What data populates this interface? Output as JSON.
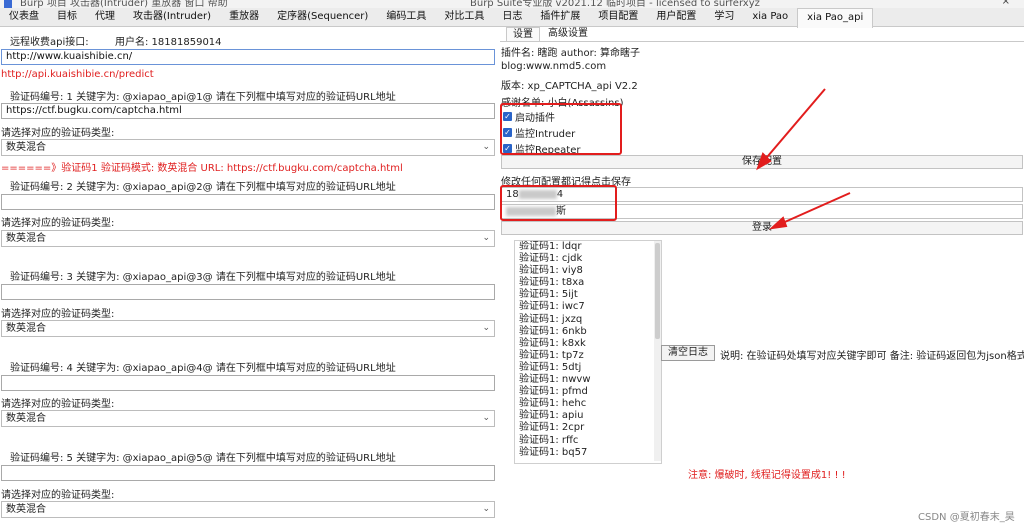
{
  "titlebar": {
    "left_text": "Burp 项目 攻击器(Intruder) 重放器 窗口 帮助",
    "center_text": "Burp Suite专业版 v2021.12 临时项目 - licensed to surferxyz",
    "close": "×"
  },
  "tabs": [
    "仪表盘",
    "目标",
    "代理",
    "攻击器(Intruder)",
    "重放器",
    "定序器(Sequencer)",
    "编码工具",
    "对比工具",
    "日志",
    "插件扩展",
    "项目配置",
    "用户配置",
    "学习",
    "xia Pao",
    "xia Pao_api"
  ],
  "left": {
    "api_label": "远程收费api接口:",
    "username_label": "用户名: 18181859014",
    "api_url": "http://www.kuaishibie.cn/",
    "predict_url": "http://api.kuaishibie.cn/predict",
    "blocks": [
      {
        "header": "验证码编号: 1  关键字为: @xiapao_api@1@    请在下列框中填写对应的验证码URL地址",
        "url": "https://ctf.bugku.com/captcha.html",
        "type_label": "请选择对应的验证码类型:",
        "type_value": "数英混合",
        "result": "======》验证码1  验证码模式: 数英混合  URL: https://ctf.bugku.com/captcha.html"
      },
      {
        "header": "验证码编号: 2  关键字为: @xiapao_api@2@    请在下列框中填写对应的验证码URL地址",
        "url": "",
        "type_label": "请选择对应的验证码类型:",
        "type_value": "数英混合"
      },
      {
        "header": "验证码编号: 3  关键字为: @xiapao_api@3@    请在下列框中填写对应的验证码URL地址",
        "url": "",
        "type_label": "请选择对应的验证码类型:",
        "type_value": "数英混合"
      },
      {
        "header": "验证码编号: 4  关键字为: @xiapao_api@4@    请在下列框中填写对应的验证码URL地址",
        "url": "",
        "type_label": "请选择对应的验证码类型:",
        "type_value": "数英混合"
      },
      {
        "header": "验证码编号: 5  关键字为: @xiapao_api@5@    请在下列框中填写对应的验证码URL地址",
        "url": "",
        "type_label": "请选择对应的验证码类型:",
        "type_value": "数英混合"
      }
    ]
  },
  "right": {
    "subtabs": [
      "设置",
      "高级设置"
    ],
    "plugin_name": "插件名: 瞎跑 author: 算命瞎子",
    "blog": "blog:www.nmd5.com",
    "version": "版本: xp_CAPTCHA_api V2.2",
    "thanks": "感谢名单: 小白(Assassins)",
    "checkboxes": [
      "启动插件",
      "监控Intruder",
      "监控Repeater"
    ],
    "save_button": "保存配置",
    "save_hint": "修改任何配置都记得点击保存",
    "account_prefix": "18",
    "account_suffix": "4",
    "password_suffix": "斯",
    "login_button": "登录",
    "log_lines": [
      "验证码1: ldqr",
      "验证码1: cjdk",
      "验证码1: viy8",
      "验证码1: t8xa",
      "验证码1: 5ijt",
      "验证码1: iwc7",
      "验证码1: jxzq",
      "验证码1: 6nkb",
      "验证码1: k8xk",
      "验证码1: tp7z",
      "验证码1: 5dtj",
      "验证码1: nwvw",
      "验证码1: pfmd",
      "验证码1: hehc",
      "验证码1: apiu",
      "验证码1: 2cpr",
      "验证码1: rffc",
      "验证码1: bq57"
    ],
    "clear_log": "清空日志",
    "note": "说明: 在验证码处填写对应关键字即可  备注: 验证码返回包为json格式也支持",
    "warning": "注意: 爆破时, 线程记得设置成1! ! !",
    "watermark": "CSDN @夏初春末_昊"
  },
  "colors": {
    "accent": "#2a64c8",
    "annotation_red": "#e21d1d"
  }
}
